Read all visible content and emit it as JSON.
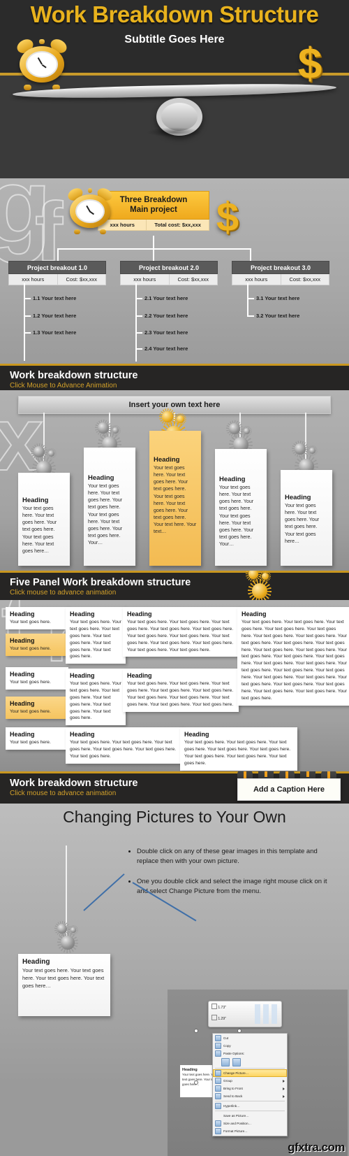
{
  "slide1": {
    "title": "Work Breakdown Structure",
    "subtitle": "Subtitle Goes Here",
    "dollar_glyph": "$",
    "icons": {
      "clock": "alarm-clock-icon",
      "money": "dollar-sign-icon"
    }
  },
  "slide2": {
    "main": {
      "title_line1": "Three Breakdown",
      "title_line2": "Main project",
      "hours": "xxx hours",
      "cost": "Total cost: $xx,xxx"
    },
    "breakouts": [
      {
        "title": "Project breakout 1.0",
        "hours": "xxx hours",
        "cost": "Cost: $xx,xxx",
        "items": [
          "1.1 Your  text here",
          "1.2 Your  text here",
          "1.3 Your  text here"
        ]
      },
      {
        "title": "Project breakout 2.0",
        "hours": "xxx hours",
        "cost": "Cost: $xx,xxx",
        "items": [
          "2.1 Your  text here",
          "2.2 Your  text here",
          "2.3 Your  text here",
          "2.4 Your  text here"
        ]
      },
      {
        "title": "Project breakout 3.0",
        "hours": "xxx hours",
        "cost": "Cost: $xx,xxx",
        "items": [
          "3.1 Your  text here",
          "3.2 Your  text here"
        ]
      }
    ]
  },
  "band1": {
    "title": "Work breakdown structure",
    "subtitle": "Click Mouse to Advance Animation"
  },
  "slide3": {
    "header": "Insert your own text here",
    "cards": [
      {
        "heading": "Heading",
        "body": "Your text goes here. Your text goes here. Your text goes here. Your text goes here. Your text goes here…"
      },
      {
        "heading": "Heading",
        "body": "Your text goes here. Your text goes here.  Your text goes here. Your text goes here. Your text goes here. Your text goes here. Your…"
      },
      {
        "heading": "Heading",
        "body": "Your text goes here. Your text goes here.  Your text goes here. Your text goes here. Your text goes here. Your text goes here. Your text here.  Your text…"
      },
      {
        "heading": "Heading",
        "body": "Your text goes here. Your text goes here.  Your text goes here. Your text goes here. Your text goes here. Your text goes here. Your…"
      },
      {
        "heading": "Heading",
        "body": "Your text goes here. Your text goes here. Your text goes here. Your text goes here…"
      }
    ],
    "highlight_index": 2
  },
  "band2": {
    "title": "Five Panel Work breakdown structure",
    "subtitle": "Click mouse to advance animation"
  },
  "slide4": {
    "left_column": [
      {
        "heading": "Heading",
        "body": "Your text goes here.",
        "highlight": false
      },
      {
        "heading": "Heading",
        "body": "Your text goes here.",
        "highlight": true
      },
      {
        "heading": "Heading",
        "body": "Your text goes here.",
        "highlight": false
      },
      {
        "heading": "Heading",
        "body": "Your text goes here.",
        "highlight": true
      },
      {
        "heading": "Heading",
        "body": "Your text goes here.",
        "highlight": false
      }
    ],
    "col2": [
      {
        "heading": "Heading",
        "body": "Your text goes here. Your text goes here. Your text goes here. Your text goes here. Your text goes here. Your text goes here."
      },
      {
        "heading": "Heading",
        "body": "Your text goes here. Your text goes here. Your text goes here. Your text goes here. Your text goes here. Your text goes here."
      },
      {
        "heading": "Heading",
        "body": "Your text goes here. Your text goes here. Your text goes here. Your text goes here. Your text goes here. Your text goes here."
      }
    ],
    "col3": [
      {
        "heading": "Heading",
        "body": "Your text goes here. Your text goes here. Your text goes here. Your text goes here. Your text goes here. Your text goes here. Your text goes here. Your text goes here. Your text goes here. Your text goes here. Your text goes here. Your text goes here."
      },
      {
        "heading": "Heading",
        "body": "Your text goes here. Your  text goes here. Your text goes here. Your text goes here. Your text goes here. Your text goes here. Your text goes here. Your text goes here. Your text goes here. Your text goes here."
      },
      {
        "heading": "Heading",
        "body": "Your text goes here. Your  text goes here. Your text goes here. Your text goes here. Your text goes here. Your text goes here. Your text goes here. Your text goes here."
      }
    ],
    "col4": [
      {
        "heading": "Heading",
        "body": "Your text goes here. Your text goes here. Your text goes here. Your text goes here. Your text goes here. Your text goes here. Your text goes here. Your text goes here. Your text goes here. Your text goes here. Your text goes here. Your text goes here. Your text goes here. Your text goes here. Your text goes here. Your text goes here. Your text goes here. Your text goes here. Your text goes here. Your text goes here. Your text goes here. Your text goes here. Your text goes here. Your text goes here. Your text goes here. Your text goes here. Your text goes here. Your text goes here."
      },
      {
        "heading": "Heading",
        "body": "Your text goes here. Your text goes here. Your text goes here. Your text goes here. Your text goes here. Your text goes here. Your text goes here. Your text goes here."
      }
    ]
  },
  "band3": {
    "title": "Work breakdown structure",
    "subtitle": "Click mouse to advance animation",
    "caption": "Add a Caption Here"
  },
  "slide5": {
    "title": "Changing Pictures to Your Own",
    "bullets": [
      "Double click on any of these gear images in this template and replace then with your own picture.",
      "One you double click and select the image right mouse click on it and select Change Picture from the menu."
    ],
    "card": {
      "heading": "Heading",
      "body": "Your text goes here. Your text goes here. Your text goes here. Your text goes here…"
    },
    "screenshot": {
      "size_height": "1.73\"",
      "size_width": "1.29\"",
      "mini_card": {
        "heading": "Heading",
        "body": "Your text goes here. Your text goes here. Your text goes here…"
      },
      "context_menu": [
        {
          "label": "Cut",
          "icon": "scissors-icon",
          "submenu": false,
          "selected": false
        },
        {
          "label": "Copy",
          "icon": "copy-icon",
          "submenu": false,
          "selected": false
        },
        {
          "label": "Paste Options:",
          "icon": "paste-icon",
          "submenu": false,
          "selected": false
        },
        {
          "label": "Change Picture…",
          "icon": "picture-icon",
          "submenu": false,
          "selected": true
        },
        {
          "label": "Group",
          "icon": "group-icon",
          "submenu": true,
          "selected": false
        },
        {
          "label": "Bring to Front",
          "icon": "bring-front-icon",
          "submenu": true,
          "selected": false
        },
        {
          "label": "Send to Back",
          "icon": "send-back-icon",
          "submenu": true,
          "selected": false
        },
        {
          "label": "Hyperlink…",
          "icon": "hyperlink-icon",
          "submenu": false,
          "selected": false
        },
        {
          "label": "Save as Picture…",
          "icon": "save-picture-icon",
          "submenu": false,
          "selected": false
        },
        {
          "label": "Size and Position…",
          "icon": "size-position-icon",
          "submenu": false,
          "selected": false
        },
        {
          "label": "Format Picture…",
          "icon": "format-picture-icon",
          "submenu": false,
          "selected": false
        }
      ]
    }
  },
  "watermark": {
    "text": "gfxtra.com"
  },
  "colors": {
    "accent": "#e8b21d",
    "dark": "#262524",
    "band_rule": "#c9971f",
    "highlight": "#f5c45f"
  }
}
